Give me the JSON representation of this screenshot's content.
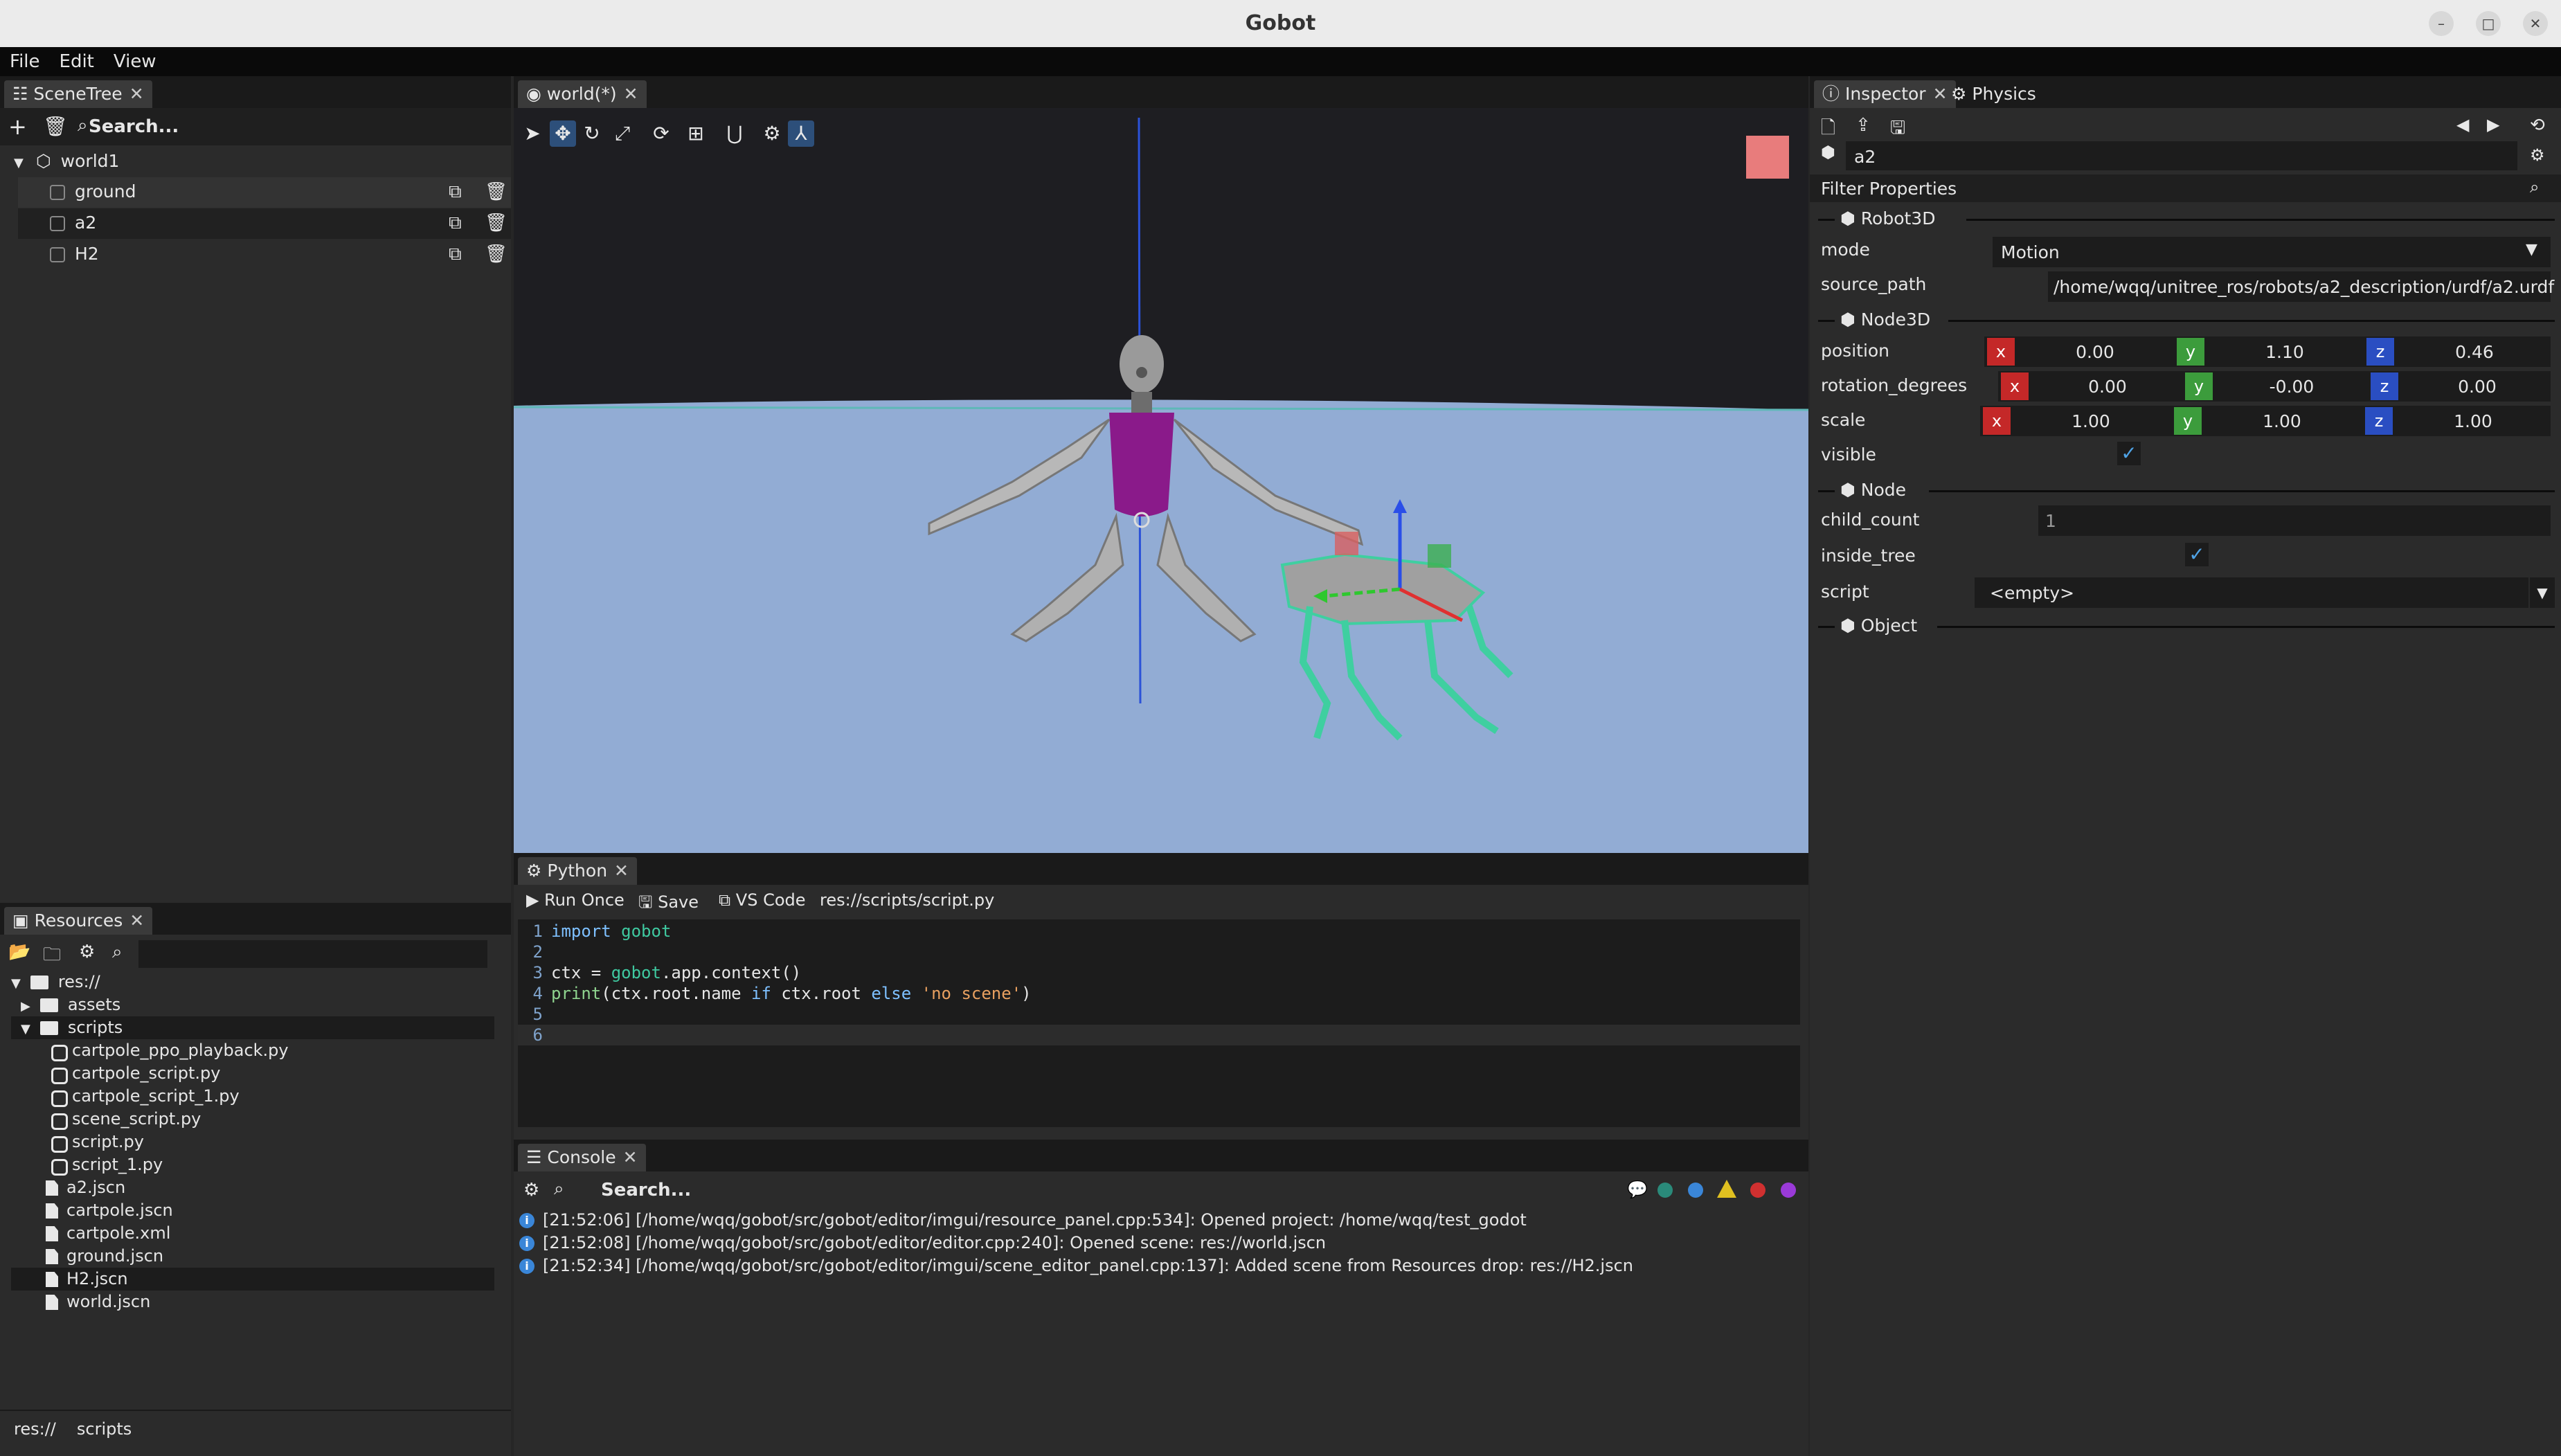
{
  "window": {
    "title": "Gobot"
  },
  "menu": [
    "File",
    "Edit",
    "View"
  ],
  "scene_tree": {
    "tab_label": "SceneTree",
    "search_placeholder": "Search...",
    "root": "world1",
    "children": [
      "ground",
      "a2",
      "H2"
    ]
  },
  "viewport": {
    "tab_label": "world(*)"
  },
  "resources": {
    "tab_label": "Resources",
    "root": "res://",
    "items": [
      {
        "name": "assets",
        "type": "folder",
        "depth": 1,
        "expanded": false
      },
      {
        "name": "scripts",
        "type": "folder",
        "depth": 1,
        "expanded": true
      },
      {
        "name": "cartpole_ppo_playback.py",
        "type": "py",
        "depth": 2
      },
      {
        "name": "cartpole_script.py",
        "type": "py",
        "depth": 2
      },
      {
        "name": "cartpole_script_1.py",
        "type": "py",
        "depth": 2
      },
      {
        "name": "scene_script.py",
        "type": "py",
        "depth": 2
      },
      {
        "name": "script.py",
        "type": "py",
        "depth": 2
      },
      {
        "name": "script_1.py",
        "type": "py",
        "depth": 2
      },
      {
        "name": "a2.jscn",
        "type": "file",
        "depth": 1
      },
      {
        "name": "cartpole.jscn",
        "type": "file",
        "depth": 1
      },
      {
        "name": "cartpole.xml",
        "type": "file",
        "depth": 1
      },
      {
        "name": "ground.jscn",
        "type": "file",
        "depth": 1
      },
      {
        "name": "H2.jscn",
        "type": "file",
        "depth": 1
      },
      {
        "name": "world.jscn",
        "type": "file",
        "depth": 1
      }
    ],
    "breadcrumb": [
      "res://",
      "scripts"
    ]
  },
  "python": {
    "tab_label": "Python",
    "run_once": "Run Once",
    "save": "Save",
    "vscode": "VS Code",
    "path": "res://scripts/script.py",
    "lines": [
      {
        "n": "1",
        "code": "import gobot"
      },
      {
        "n": "2",
        "code": ""
      },
      {
        "n": "3",
        "code": "ctx = gobot.app.context()"
      },
      {
        "n": "4",
        "code": "print(ctx.root.name if ctx.root else 'no scene')"
      },
      {
        "n": "5",
        "code": ""
      },
      {
        "n": "6",
        "code": ""
      }
    ]
  },
  "console": {
    "tab_label": "Console",
    "search_placeholder": "Search...",
    "entries": [
      "[21:52:06] [/home/wqq/gobot/src/gobot/editor/imgui/resource_panel.cpp:534]: Opened project: /home/wqq/test_godot",
      "[21:52:08] [/home/wqq/gobot/src/gobot/editor/editor.cpp:240]: Opened scene: res://world.jscn",
      "[21:52:34] [/home/wqq/gobot/src/gobot/editor/imgui/scene_editor_panel.cpp:137]: Added scene from Resources drop: res://H2.jscn"
    ]
  },
  "inspector": {
    "tab_label": "Inspector",
    "physics_tab_label": "Physics",
    "node_name": "a2",
    "filter_label": "Filter Properties",
    "sections": {
      "robot": "Robot3D",
      "node3d": "Node3D",
      "node": "Node",
      "object": "Object"
    },
    "mode_label": "mode",
    "mode_value": "Motion",
    "source_path_label": "source_path",
    "source_path_value": "/home/wqq/unitree_ros/robots/a2_description/urdf/a2.urdf",
    "position_label": "position",
    "position": {
      "x": "0.00",
      "y": "1.10",
      "z": "0.46"
    },
    "rotation_label": "rotation_degrees",
    "rotation": {
      "x": "0.00",
      "y": "-0.00",
      "z": "0.00"
    },
    "scale_label": "scale",
    "scale": {
      "x": "1.00",
      "y": "1.00",
      "z": "1.00"
    },
    "visible_label": "visible",
    "visible": true,
    "child_count_label": "child_count",
    "child_count_value": "1",
    "inside_tree_label": "inside_tree",
    "inside_tree": true,
    "script_label": "script",
    "script_value": "<empty>",
    "axis": {
      "x": "x",
      "y": "y",
      "z": "z"
    }
  },
  "colors": {
    "axis_x": "#c42828",
    "axis_y": "#3c9c3c",
    "axis_z": "#2a4ec2",
    "accent": "#4fa3e6"
  }
}
